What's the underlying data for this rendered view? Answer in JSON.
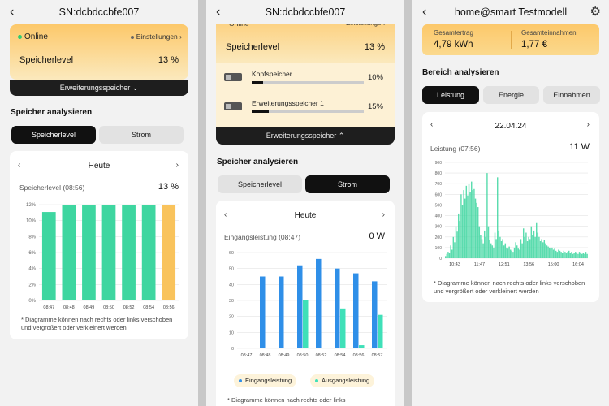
{
  "panel1": {
    "title": "SN:dcbdccbfe007",
    "online": "Online",
    "settings": "Einstellungen",
    "level_label": "Speicherlevel",
    "level_value": "13 %",
    "expand_label": "Erweiterungsspeicher",
    "section": "Speicher analysieren",
    "tabs": [
      "Speicherlevel",
      "Strom"
    ],
    "active_tab": "Speicherlevel",
    "card_title": "Heute",
    "metric_label": "Speicherlevel (08:56)",
    "metric_value": "13 %",
    "note": "* Diagramme können nach rechts oder links verschoben und vergrößert oder verkleinert werden"
  },
  "panel2": {
    "title": "SN:dcbdccbfe007",
    "cut_online": "Online",
    "cut_settings": "Einstellungen",
    "level_label": "Speicherlevel",
    "level_value": "13 %",
    "modules": [
      {
        "name": "Kopfspeicher",
        "pct": "10%",
        "fill": 0.1
      },
      {
        "name": "Erweiterungsspeicher 1",
        "pct": "15%",
        "fill": 0.15
      }
    ],
    "expand_label": "Erweiterungsspeicher",
    "section": "Speicher analysieren",
    "tabs": [
      "Speicherlevel",
      "Strom"
    ],
    "active_tab": "Strom",
    "card_title": "Heute",
    "metric_label": "Eingangsleistung (08:47)",
    "metric_value": "0 W",
    "legend": [
      "Eingangsleistung",
      "Ausgangsleistung"
    ],
    "note": "* Diagramme können nach rechts oder links"
  },
  "panel3": {
    "title": "home@smart Testmodell",
    "stats": [
      {
        "label": "Gesamtertrag",
        "value": "4,79 kWh"
      },
      {
        "label": "Gesamteinnahmen",
        "value": "1,77 €"
      }
    ],
    "section": "Bereich analysieren",
    "tabs": [
      "Leistung",
      "Energie",
      "Einnahmen"
    ],
    "active_tab": "Leistung",
    "date": "22.04.24",
    "metric_label": "Leistung (07:56)",
    "metric_value": "11 W",
    "note": "* Diagramme können nach rechts oder links verschoben und vergrößert oder verkleinert werden"
  },
  "colors": {
    "accent_yellow": "#fbc866",
    "bar_green": "#3ed6a0",
    "bar_yellow": "#f9c35c",
    "bar_blue": "#2f8fe8",
    "bar_teal": "#3fe0b8",
    "dark": "#111111"
  },
  "chart_data": [
    {
      "type": "bar",
      "categories": [
        "08:47",
        "08:48",
        "08:49",
        "08:50",
        "08:52",
        "08:54",
        "08:56"
      ],
      "values": [
        12,
        13,
        13,
        13,
        13,
        13,
        13
      ],
      "highlight_last": true,
      "y_ticks": [
        "0%",
        "2%",
        "4%",
        "6%",
        "8%",
        "10%",
        "12%"
      ],
      "ylim": [
        0,
        13
      ],
      "grid": true
    },
    {
      "type": "bar",
      "categories": [
        "08:47",
        "08:48",
        "08:49",
        "08:50",
        "08:52",
        "08:54",
        "08:56",
        "08:57"
      ],
      "series": [
        {
          "name": "Eingangsleistung",
          "values": [
            0,
            45,
            45,
            52,
            56,
            50,
            47,
            42
          ]
        },
        {
          "name": "Ausgangsleistung",
          "values": [
            0,
            0,
            0,
            30,
            0,
            25,
            2,
            21
          ]
        }
      ],
      "y_ticks": [
        "0",
        "10",
        "20",
        "30",
        "40",
        "50",
        "60"
      ],
      "ylim": [
        0,
        60
      ],
      "grid": true,
      "legend": "bottom"
    },
    {
      "type": "area",
      "x_ticks": [
        "10:43",
        "11:47",
        "12:51",
        "13:56",
        "15:00",
        "16:04"
      ],
      "y_ticks": [
        "0",
        "100",
        "200",
        "300",
        "400",
        "500",
        "600",
        "700",
        "800",
        "900"
      ],
      "ylim": [
        0,
        900
      ],
      "values": [
        20,
        40,
        60,
        50,
        120,
        80,
        200,
        150,
        300,
        250,
        420,
        350,
        600,
        500,
        640,
        560,
        680,
        590,
        700,
        620,
        720,
        640,
        650,
        560,
        520,
        480,
        300,
        220,
        180,
        140,
        260,
        200,
        800,
        300,
        170,
        140,
        120,
        100,
        240,
        180,
        760,
        260,
        200,
        160,
        180,
        120,
        140,
        100,
        90,
        110,
        80,
        70,
        60,
        100,
        150,
        120,
        90,
        80,
        180,
        140,
        280,
        200,
        240,
        160,
        200,
        180,
        300,
        220,
        260,
        200,
        330,
        240,
        200,
        160,
        180,
        150,
        170,
        140,
        120,
        110,
        100,
        90,
        100,
        80,
        90,
        70,
        60,
        80,
        70,
        60,
        50,
        70,
        60,
        50,
        60,
        70,
        50,
        60,
        40,
        50,
        60,
        50,
        40,
        60,
        50,
        40,
        50,
        40,
        60,
        40
      ],
      "grid": true
    }
  ]
}
